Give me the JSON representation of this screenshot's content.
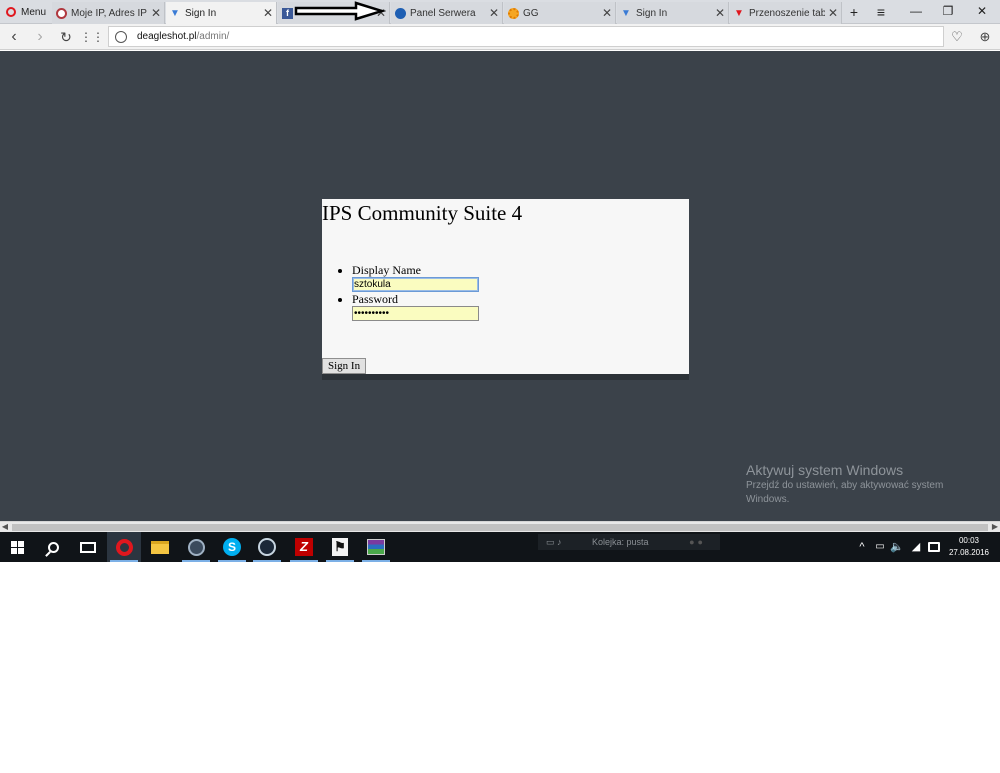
{
  "browser": {
    "menu_label": "Menu",
    "tabs": [
      {
        "label": "Moje IP, Adres IP -",
        "icon": "ip-site-icon"
      },
      {
        "label": "Sign In",
        "icon": "v-favicon-icon"
      },
      {
        "label": "",
        "icon": "facebook-icon"
      },
      {
        "label": "Panel Serwera",
        "icon": "panel-favicon-icon"
      },
      {
        "label": "GG",
        "icon": "gg-icon"
      },
      {
        "label": "Sign In",
        "icon": "v-favicon-icon"
      },
      {
        "label": "Przenoszenie tabel",
        "icon": "red-v-favicon-icon"
      }
    ],
    "url_host": "deagleshot.pl",
    "url_path": "/admin/"
  },
  "page": {
    "title": "IPS Community Suite 4",
    "fields": {
      "display_name_label": "Display Name",
      "display_name_value": "sztokula",
      "password_label": "Password",
      "password_value": "••••••••••"
    },
    "submit_label": "Sign In",
    "watermark_title": "Aktywuj system Windows",
    "watermark_sub": "Przejdź do ustawień, aby aktywować system Windows."
  },
  "taskbar": {
    "media_label": "Kolejka: pusta",
    "clock_time": "00:03",
    "clock_date": "27.08.2016"
  },
  "colors": {
    "page_bg": "#3b424a",
    "card_bg": "#f7f7f7",
    "autofill_bg": "#fafcc0",
    "taskbar_bg": "#101418",
    "opera_red": "#e0171e"
  }
}
